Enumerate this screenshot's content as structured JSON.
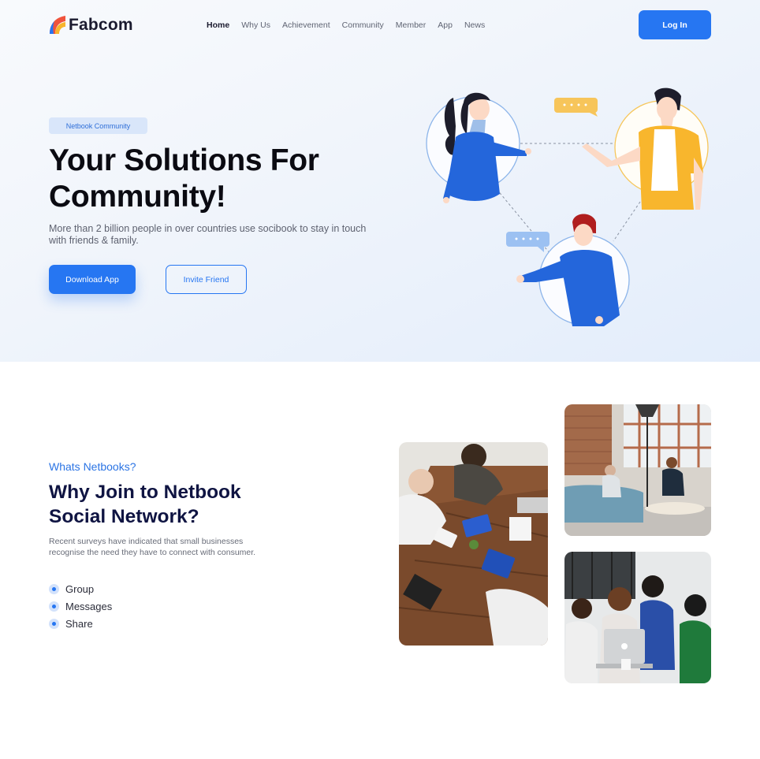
{
  "brand": {
    "name": "Fabcom",
    "colors": {
      "primary": "#2676f2",
      "logo_red": "#f0533c",
      "logo_yellow": "#f7b52c",
      "logo_blue": "#2676f2"
    }
  },
  "nav": {
    "items": [
      "Home",
      "Why Us",
      "Achievement",
      "Community",
      "Member",
      "App",
      "News"
    ],
    "active": "Home",
    "login_label": "Log In"
  },
  "hero": {
    "badge": "Netbook Community",
    "title_line1": "Your Solutions For",
    "title_line2": "Community!",
    "description": "More than 2 billion people in over countries use socibook to stay in touch with friends & family.",
    "download_label": "Download App",
    "invite_label": "Invite Friend"
  },
  "about": {
    "eyebrow": "Whats Netbooks?",
    "title_line1": "Why Join to Netbook",
    "title_line2": "Social Network?",
    "description": "Recent surveys have indicated that small businesses recognise the need they have to connect with consumer.",
    "features": [
      "Group",
      "Messages",
      "Share"
    ]
  },
  "icons": {
    "logo": "fabcom-logo-icon",
    "feature_bullet": "bullet-dot-icon",
    "chat": "chat-bubble-icon"
  }
}
